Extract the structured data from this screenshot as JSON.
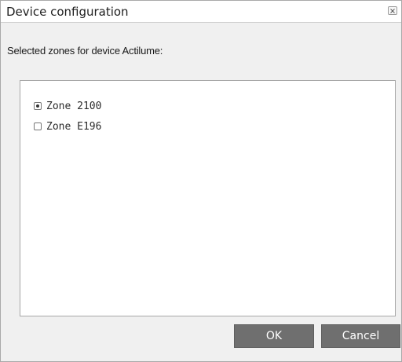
{
  "window": {
    "title": "Device configuration",
    "close_icon": "close-icon"
  },
  "main": {
    "subtitle": "Selected zones for device Actilume:",
    "zones": [
      {
        "label": "Zone 2100",
        "selected": true
      },
      {
        "label": "Zone E196",
        "selected": false
      }
    ]
  },
  "footer": {
    "ok_label": "OK",
    "cancel_label": "Cancel"
  },
  "colors": {
    "button_bg": "#6f6f6f",
    "dialog_bg": "#f0f0f0"
  }
}
